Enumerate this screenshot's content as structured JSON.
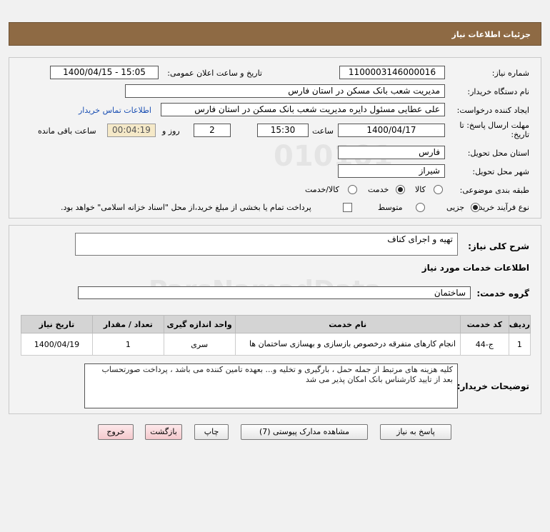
{
  "header": {
    "title": "جزئیات اطلاعات نیاز"
  },
  "form": {
    "need_number_label": "شماره نیاز:",
    "need_number": "1100003146000016",
    "announce_label": "تاریخ و ساعت اعلان عمومی:",
    "announce_value": "1400/04/15 - 15:05",
    "buyer_label": "نام دستگاه خریدار:",
    "buyer_value": "مدیریت شعب بانک مسکن در استان فارس",
    "requester_label": "ایجاد کننده درخواست:",
    "requester_value": "علی عطایی مسئول دایره مدیریت شعب بانک مسکن در استان فارس",
    "contact_link": "اطلاعات تماس خریدار",
    "deadline_label_1": "مهلت ارسال پاسخ: تا",
    "deadline_label_2": "تاریخ:",
    "deadline_date": "1400/04/17",
    "time_label": "ساعت",
    "deadline_time": "15:30",
    "days_value": "2",
    "days_label": "روز و",
    "remaining_value": "00:04:19",
    "remaining_label": "ساعت باقی مانده",
    "province_label": "استان محل تحویل:",
    "province_value": "فارس",
    "city_label": "شهر محل تحویل:",
    "city_value": "شیراز",
    "category_label": "طبقه بندی موضوعی:",
    "category_options": [
      "کالا",
      "خدمت",
      "کالا/خدمت"
    ],
    "category_selected": "خدمت",
    "process_label": "نوع فرآیند خرید :",
    "process_options": [
      "جزیی",
      "متوسط"
    ],
    "process_selected": "جزیی",
    "payment_text": "پرداخت تمام یا بخشی از مبلغ خرید،از محل \"اسناد خزانه اسلامی\" خواهد بود."
  },
  "details": {
    "summary_label": "شرح کلی نیاز:",
    "summary_value": "تهیه و اجرای کناف",
    "services_header": "اطلاعات خدمات مورد نیاز",
    "service_group_label": "گروه خدمت:",
    "service_group_value": "ساختمان",
    "table": {
      "headers": [
        "ردیف",
        "کد خدمت",
        "نام خدمت",
        "واحد اندازه گیری",
        "تعداد / مقدار",
        "تاریخ نیاز"
      ],
      "rows": [
        [
          "1",
          "ج-44",
          "انجام کارهای متفرقه درخصوص بازسازی و بهسازی ساختمان ها",
          "سری",
          "1",
          "1400/04/19"
        ]
      ]
    },
    "buyer_notes_label": "توضیحات خریدار:",
    "buyer_notes": "کلیه هزینه های مرتبط از جمله حمل ، بارگیری و تخلیه و... بعهده تامین کننده می باشد ، پرداخت صورتحساب بعد از تایید کارشناس بانک امکان پذیر می شد"
  },
  "buttons": {
    "reply": "پاسخ به نیاز",
    "attachments": "مشاهده مدارک پیوستی (7)",
    "print": "چاپ",
    "back": "بازگشت",
    "exit": "خروج"
  }
}
